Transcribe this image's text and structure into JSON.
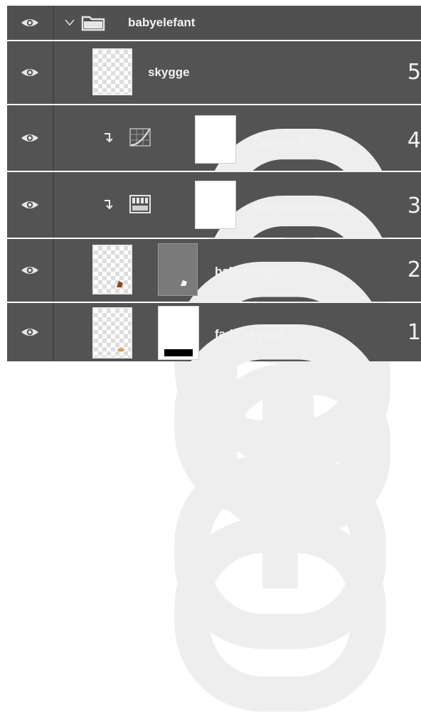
{
  "layers_panel": {
    "group": {
      "name": "babyelefant",
      "expanded": true
    },
    "layers": [
      {
        "name": "skygge",
        "number": "5",
        "kind": "pixel"
      },
      {
        "name": "Curves 5",
        "number": "4",
        "kind": "curves-adjustment",
        "clipped": true,
        "has_mask": true
      },
      {
        "name": "Hue/Saturation 4",
        "number": "3",
        "kind": "hue-saturation-adjustment",
        "clipped": true,
        "has_mask": true
      },
      {
        "name": "babyelefant",
        "number": "2",
        "kind": "smart-object",
        "has_mask": true
      },
      {
        "name": "fade skygge",
        "number": "1",
        "kind": "pixel",
        "has_mask": true
      }
    ],
    "colors": {
      "row_bg": "#535353",
      "text": "#f2f2f2",
      "separator": "#444444"
    }
  }
}
